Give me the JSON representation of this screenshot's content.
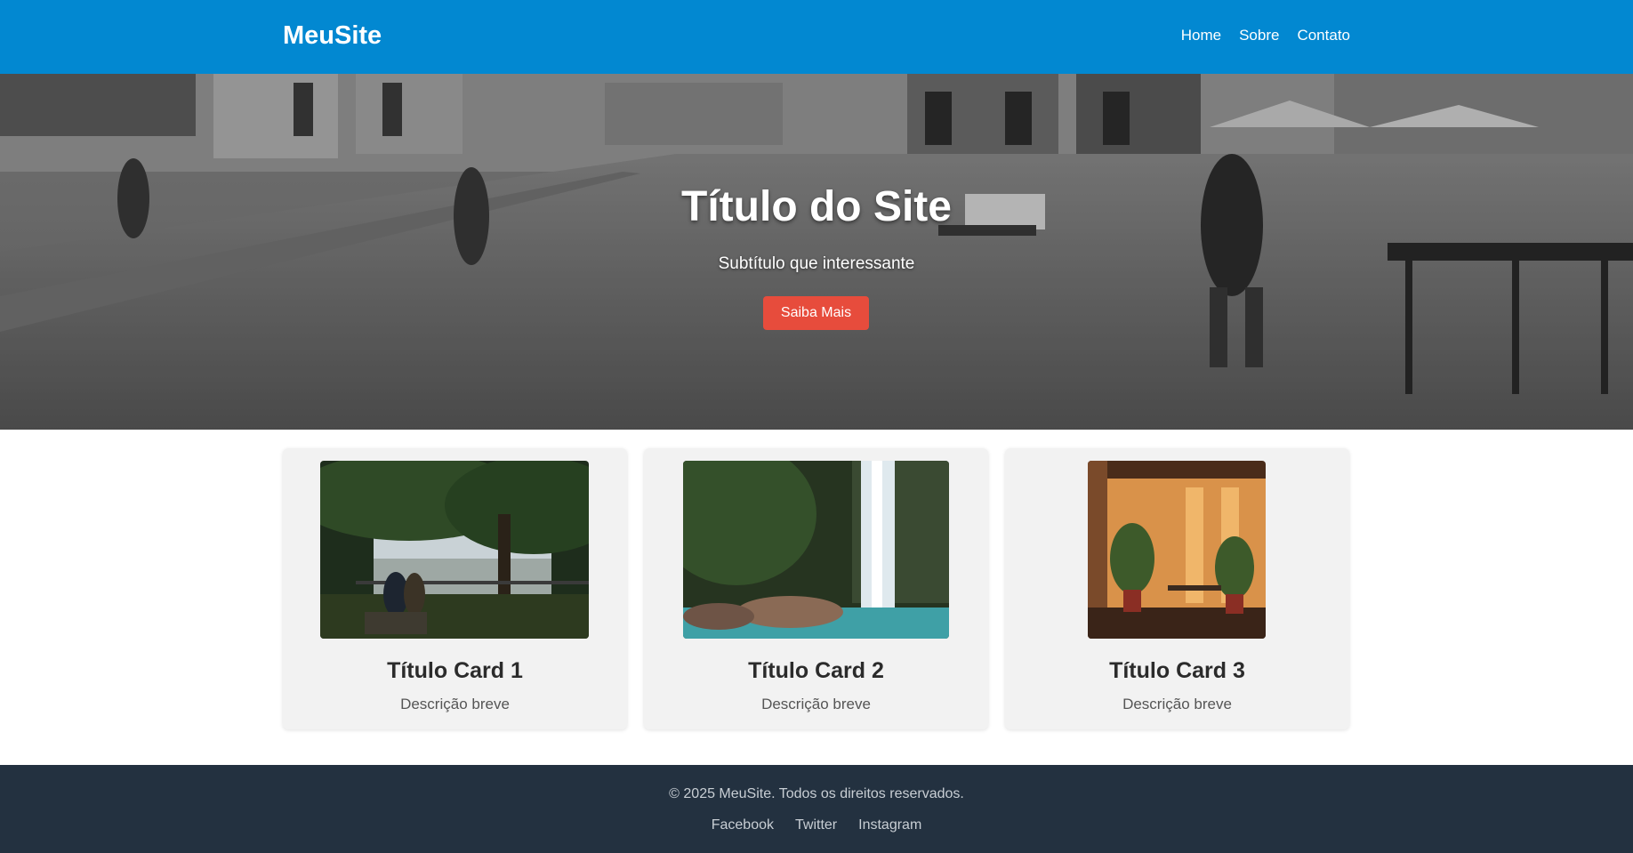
{
  "header": {
    "brand": "MeuSite",
    "nav": [
      "Home",
      "Sobre",
      "Contato"
    ]
  },
  "hero": {
    "title": "Título do Site",
    "subtitle": "Subtítulo que interessante",
    "button_label": "Saiba Mais"
  },
  "cards": [
    {
      "title": "Título Card 1",
      "description": "Descrição breve",
      "image_icon": "park-landscape-photo"
    },
    {
      "title": "Título Card 2",
      "description": "Descrição breve",
      "image_icon": "waterfall-photo"
    },
    {
      "title": "Título Card 3",
      "description": "Descrição breve",
      "image_icon": "sunlit-room-photo"
    }
  ],
  "footer": {
    "copyright": "© 2025 MeuSite. Todos os direitos reservados.",
    "links": [
      "Facebook",
      "Twitter",
      "Instagram"
    ]
  },
  "colors": {
    "header_bg": "#0288d1",
    "button_bg": "#e74c3c",
    "footer_bg": "#233140",
    "card_bg": "#f2f2f2"
  }
}
